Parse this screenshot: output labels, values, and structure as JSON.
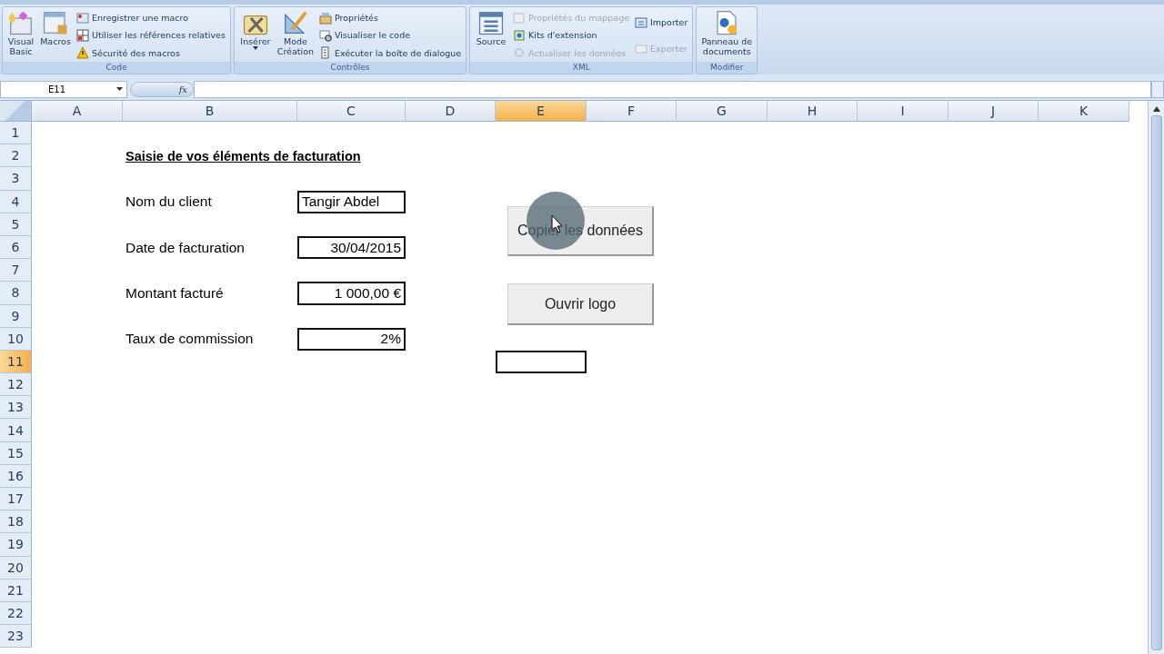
{
  "ribbon": {
    "groups": [
      {
        "label": "Code",
        "large": [
          {
            "label": "Visual Basic",
            "caret": false
          },
          {
            "label": "Macros",
            "caret": false
          }
        ],
        "columns": [
          [
            {
              "label": "Enregistrer une macro",
              "disabled": false
            },
            {
              "label": "Utiliser les références relatives",
              "disabled": false
            },
            {
              "label": "Sécurité des macros",
              "disabled": false
            }
          ]
        ]
      },
      {
        "label": "Contrôles",
        "large": [
          {
            "label": "Insérer",
            "caret": true
          },
          {
            "label": "Mode Création",
            "caret": false
          }
        ],
        "columns": [
          [
            {
              "label": "Propriétés",
              "disabled": false
            },
            {
              "label": "Visualiser le code",
              "disabled": false
            },
            {
              "label": "Exécuter la boîte de dialogue",
              "disabled": false
            }
          ]
        ]
      },
      {
        "label": "XML",
        "large": [
          {
            "label": "Source",
            "caret": false
          }
        ],
        "columns": [
          [
            {
              "label": "Propriétés du mappage",
              "disabled": true
            },
            {
              "label": "Kits d'extension",
              "disabled": false
            },
            {
              "label": "Actualiser les données",
              "disabled": true
            }
          ],
          [
            {
              "label": "Importer",
              "disabled": false
            },
            {
              "label": "Exporter",
              "disabled": true
            }
          ]
        ]
      },
      {
        "label": "Modifier",
        "large": [
          {
            "label": "Panneau de documents",
            "caret": false
          }
        ]
      }
    ]
  },
  "formula_bar": {
    "name_box": "E11",
    "fx": "fx"
  },
  "sheet": {
    "columns": [
      {
        "label": "A",
        "selected": false
      },
      {
        "label": "B",
        "selected": false
      },
      {
        "label": "C",
        "selected": false
      },
      {
        "label": "D",
        "selected": false
      },
      {
        "label": "E",
        "selected": true
      },
      {
        "label": "F",
        "selected": false
      },
      {
        "label": "G",
        "selected": false
      },
      {
        "label": "H",
        "selected": false
      },
      {
        "label": "I",
        "selected": false
      },
      {
        "label": "J",
        "selected": false
      },
      {
        "label": "K",
        "selected": false
      }
    ],
    "rows": [
      {
        "label": "1",
        "selected": false
      },
      {
        "label": "2",
        "selected": false
      },
      {
        "label": "3",
        "selected": false
      },
      {
        "label": "4",
        "selected": false
      },
      {
        "label": "5",
        "selected": false
      },
      {
        "label": "6",
        "selected": false
      },
      {
        "label": "7",
        "selected": false
      },
      {
        "label": "8",
        "selected": false
      },
      {
        "label": "9",
        "selected": false
      },
      {
        "label": "10",
        "selected": false
      },
      {
        "label": "11",
        "selected": true
      },
      {
        "label": "12",
        "selected": false
      },
      {
        "label": "13",
        "selected": false
      },
      {
        "label": "14",
        "selected": false
      },
      {
        "label": "15",
        "selected": false
      },
      {
        "label": "16",
        "selected": false
      },
      {
        "label": "17",
        "selected": false
      },
      {
        "label": "18",
        "selected": false
      },
      {
        "label": "19",
        "selected": false
      },
      {
        "label": "20",
        "selected": false
      },
      {
        "label": "21",
        "selected": false
      },
      {
        "label": "22",
        "selected": false
      },
      {
        "label": "23",
        "selected": false
      }
    ],
    "form": {
      "title": "Saisie de vos éléments de facturation",
      "fields": [
        {
          "label": "Nom du client",
          "value": "Tangir Abdel",
          "kind": "text"
        },
        {
          "label": "Date de facturation",
          "value": "30/04/2015",
          "kind": "number"
        },
        {
          "label": "Montant facturé",
          "value": "1 000,00 €",
          "kind": "number"
        },
        {
          "label": "Taux de commission",
          "value": "2%",
          "kind": "number"
        }
      ]
    },
    "buttons": [
      {
        "label": "Copier les données",
        "clicked": true
      },
      {
        "label": "Ouvrir logo",
        "clicked": false
      }
    ]
  }
}
